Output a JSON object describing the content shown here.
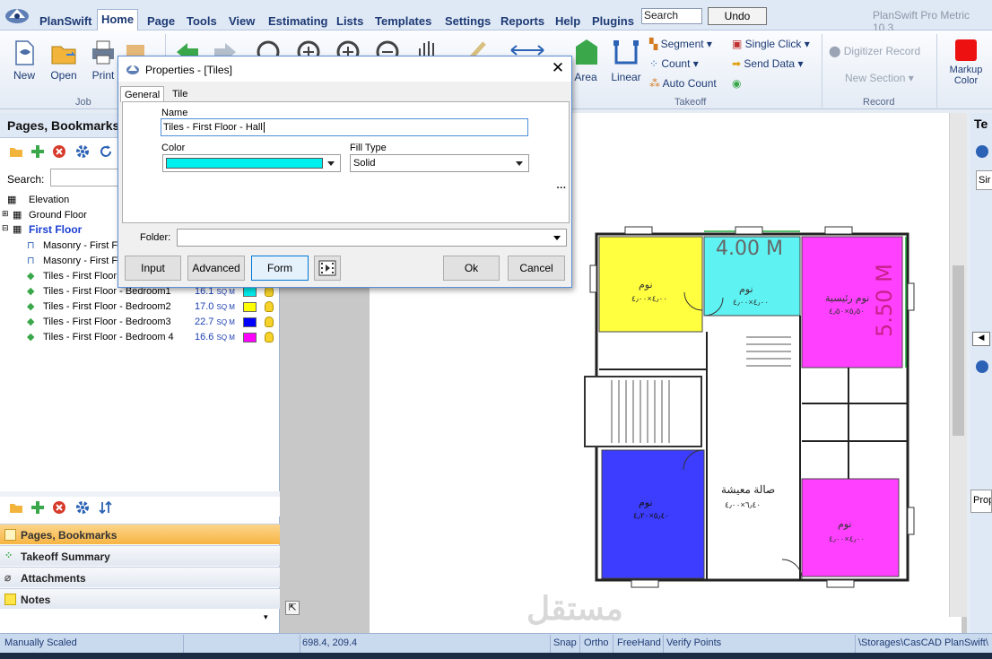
{
  "menubar": {
    "app_name": "PlanSwift",
    "items": [
      "Home",
      "Page",
      "Tools",
      "View",
      "Estimating",
      "Lists",
      "Templates",
      "Settings",
      "Reports",
      "Help",
      "Plugins"
    ],
    "search_value": "Search",
    "undo_label": "Undo",
    "window_title": "PlanSwift Pro Metric 10.3"
  },
  "ribbon": {
    "new": "New",
    "open": "Open",
    "print": "Print",
    "group_job": "Job",
    "area": "Area",
    "linear": "Linear",
    "segment": "Segment",
    "count": "Count",
    "auto_count": "Auto Count",
    "single_click": "Single Click",
    "send_data": "Send Data",
    "group_takeoff": "Takeoff",
    "digitizer_record": "Digitizer Record",
    "new_section": "New Section",
    "group_record": "Record",
    "markup_color": "Markup Color"
  },
  "left_panel": {
    "title": "Pages, Bookmarks",
    "search_label": "Search:",
    "tree": [
      {
        "label": "Elevation"
      },
      {
        "label": "Ground Floor"
      },
      {
        "label": "First Floor"
      },
      {
        "label": "Masonry - First Fl"
      },
      {
        "label": "Masonry - First Fl"
      },
      {
        "label": "Tiles - First Floor"
      },
      {
        "label": "Tiles - First Floor - Bedroom1",
        "value": "16.1",
        "unit": "SQ M",
        "color": "#00f0f0"
      },
      {
        "label": "Tiles - First Floor - Bedroom2",
        "value": "17.0",
        "unit": "SQ M",
        "color": "#ffff00"
      },
      {
        "label": "Tiles - First Floor - Bedroom3",
        "value": "22.7",
        "unit": "SQ M",
        "color": "#0000ff"
      },
      {
        "label": "Tiles - First Floor - Bedroom 4",
        "value": "16.6",
        "unit": "SQ M",
        "color": "#ff00ff"
      }
    ],
    "nav": [
      {
        "label": "Pages, Bookmarks"
      },
      {
        "label": "Takeoff Summary"
      },
      {
        "label": "Attachments"
      },
      {
        "label": "Notes"
      }
    ]
  },
  "plan": {
    "dim_top": "4.00 M",
    "dim_right": "5.50 M",
    "rooms": [
      {
        "name": "نوم",
        "size": "٤٫٠٠×٤٫٠٠",
        "color": "#ffff40"
      },
      {
        "name": "نوم",
        "size": "٤٫٠٠×٤٫٠٠",
        "color": "#5ef2f2"
      },
      {
        "name": "نوم رئيسية",
        "size": "٥٫٥٠×٤٫٥٠",
        "color": "#ff40ff"
      },
      {
        "name": "نوم",
        "size": "٥٫٤٠×٤٫٢٠",
        "color": "#3d3dff"
      },
      {
        "name": "صالة معيشة",
        "size": "٦٫٤٠×٤٫٠٠",
        "color": "#ffffff"
      },
      {
        "name": "نوم",
        "size": "٤٫٠٠×٤٫٠٠",
        "color": "#ff40ff"
      }
    ],
    "watermark": "مستقل"
  },
  "status": {
    "scale": "Manually Scaled",
    "coords": "698.4, 209.4",
    "snap": "Snap",
    "ortho": "Ortho",
    "freehand": "FreeHand",
    "verify": "Verify Points",
    "path": "\\Storages\\CasCAD PlanSwift\\"
  },
  "right_panel": {
    "title_partial": "Te",
    "input_partial": "Sir",
    "prop_partial": "Prop"
  },
  "dialog": {
    "title": "Properties - [Tiles]",
    "tabs": [
      "General",
      "Tile"
    ],
    "name_label": "Name",
    "name_value": "Tiles - First Floor - Hall",
    "color_label": "Color",
    "color_value": "#00f0f0",
    "fill_label": "Fill Type",
    "fill_value": "Solid",
    "folder_label": "Folder:",
    "buttons": {
      "input": "Input",
      "advanced": "Advanced",
      "form": "Form",
      "ok": "Ok",
      "cancel": "Cancel"
    }
  }
}
